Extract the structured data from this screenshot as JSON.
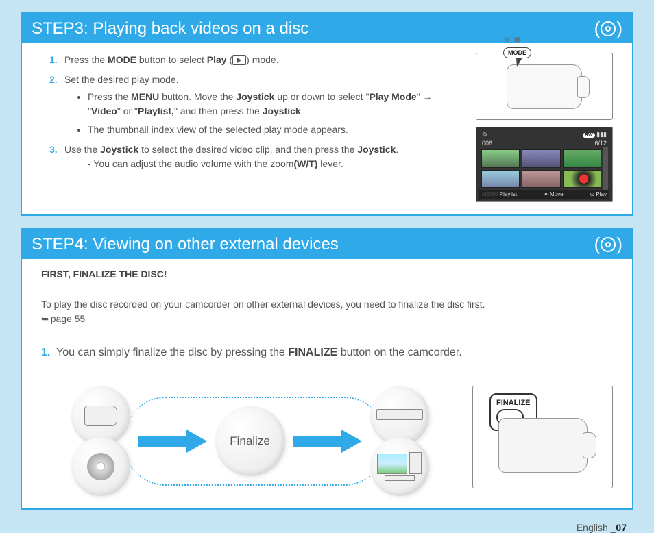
{
  "step3": {
    "title": "STEP3: Playing back videos on a disc",
    "item1_a": "Press the ",
    "item1_mode": "MODE",
    "item1_b": " button to select ",
    "item1_play": "Play",
    "item1_c": " mode.",
    "item2": "Set the desired play mode.",
    "bullet1_a": "Press the ",
    "bullet1_menu": "MENU",
    "bullet1_b": " button. Move the ",
    "bullet1_joy": "Joystick",
    "bullet1_c": " up or down to select \"",
    "bullet1_playmode": "Play Mode",
    "bullet1_d": "\" ",
    "bullet1_arrow": "→",
    "bullet1_e": " \"",
    "bullet1_video": "Video",
    "bullet1_f": "\" or \"",
    "bullet1_playlist": "Playlist,",
    "bullet1_g": "\" and then press the ",
    "bullet1_joy2": "Joystick",
    "bullet1_h": ".",
    "bullet2": "The thumbnail index view of the selected play mode appears.",
    "item3_a": "Use the ",
    "item3_joy": "Joystick",
    "item3_b": " to select the desired video clip, and then press the ",
    "item3_joy2": "Joystick",
    "item3_c": ".",
    "item3_sub_a": "You can adjust the audio volume with the zoom",
    "item3_wt": "(W/T)",
    "item3_sub_b": " lever.",
    "mode_label": "MODE",
    "lcd": {
      "disc_icon": "⊚",
      "rw": "RW",
      "batt": "▮▮▮",
      "counter_left": "006",
      "counter_right": "6/12",
      "menu": "MENU",
      "playlist": "Playlist",
      "move_icon": "✦",
      "move": "Move",
      "play_icon": "⊙",
      "play": "Play"
    }
  },
  "step4": {
    "title": "STEP4: Viewing on other external devices",
    "first": "FIRST, FINALIZE THE DISC!",
    "intro": "To play the disc recorded on your camcorder on other external devices, you need to finalize the disc first.",
    "pageref": "page 55",
    "item1_a": "You can simply finalize the disc by pressing the ",
    "item1_fin": "FINALIZE",
    "item1_b": " button on the camcorder.",
    "finalize_circle": "Finalize",
    "finalize_badge": "FINALIZE"
  },
  "footer": {
    "lang": "English _",
    "page": "07"
  }
}
